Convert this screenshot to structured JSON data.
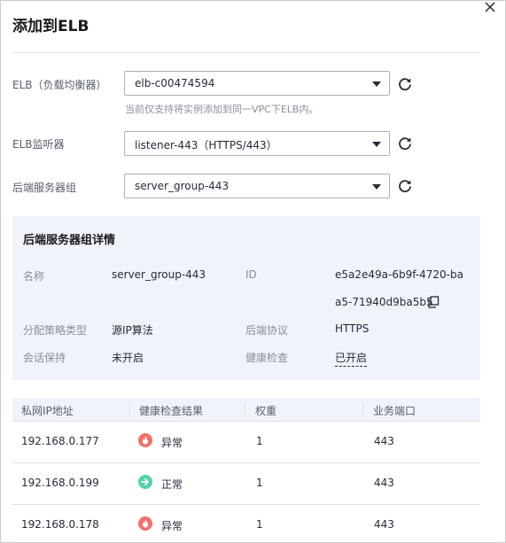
{
  "dialog": {
    "title": "添加到ELB"
  },
  "form": {
    "elb": {
      "label": "ELB（负载均衡器）",
      "value": "elb-c00474594",
      "hint": "当前仅支持将实例添加到同一VPC下ELB内。"
    },
    "listener": {
      "label": "ELB监听器",
      "value": "listener-443（HTTPS/443）"
    },
    "server_group": {
      "label": "后端服务器组",
      "value": "server_group-443"
    }
  },
  "detail": {
    "title": "后端服务器组详情",
    "name_label": "名称",
    "name_value": "server_group-443",
    "id_label": "ID",
    "id_line1": "e5a2e49a-6b9f-4720-ba",
    "id_line2": "a5-71940d9ba5b5",
    "policy_label": "分配策略类型",
    "policy_value": "源IP算法",
    "protocol_label": "后端协议",
    "protocol_value": "HTTPS",
    "session_label": "会话保持",
    "session_value": "未开启",
    "health_label": "健康检查",
    "health_value": "已开启"
  },
  "table": {
    "headers": [
      "私网IP地址",
      "健康检查结果",
      "权重",
      "业务端口"
    ],
    "rows": [
      {
        "ip": "192.168.0.177",
        "status": "异常",
        "status_type": "error",
        "weight": "1",
        "port": "443"
      },
      {
        "ip": "192.168.0.199",
        "status": "正常",
        "status_type": "ok",
        "weight": "1",
        "port": "443"
      },
      {
        "ip": "192.168.0.178",
        "status": "异常",
        "status_type": "error",
        "weight": "1",
        "port": "443"
      }
    ]
  },
  "colors": {
    "error": "#f66f6a",
    "ok": "#50d4ab"
  }
}
